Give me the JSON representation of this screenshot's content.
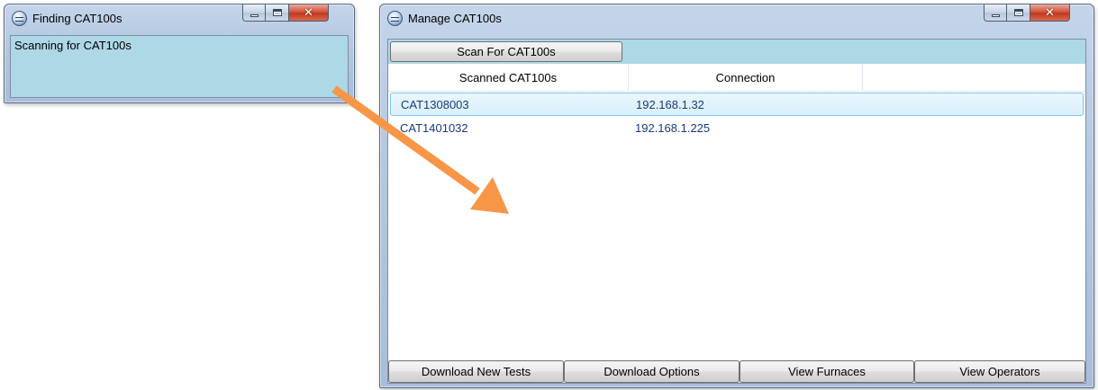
{
  "finding_window": {
    "title": "Finding CAT100s",
    "status_text": "Scanning for CAT100s",
    "controls": {
      "minimize": "minimize-icon",
      "maximize": "maximize-icon",
      "close": "close-icon"
    }
  },
  "manage_window": {
    "title": "Manage CAT100s",
    "scan_button_label": "Scan For CAT100s",
    "columns": [
      "Scanned CAT100s",
      "Connection",
      ""
    ],
    "rows": [
      {
        "name": "CAT1308003",
        "connection": "192.168.1.32",
        "selected": true
      },
      {
        "name": "CAT1401032",
        "connection": "192.168.1.225",
        "selected": false
      }
    ],
    "buttons": [
      "Download New Tests",
      "Download Options",
      "View Furnaces",
      "View Operators"
    ]
  },
  "colors": {
    "client_background": "#add8e6",
    "arrow": "#f79646",
    "row_text": "#1b3a7a",
    "selection_border": "#7fc5eb"
  }
}
